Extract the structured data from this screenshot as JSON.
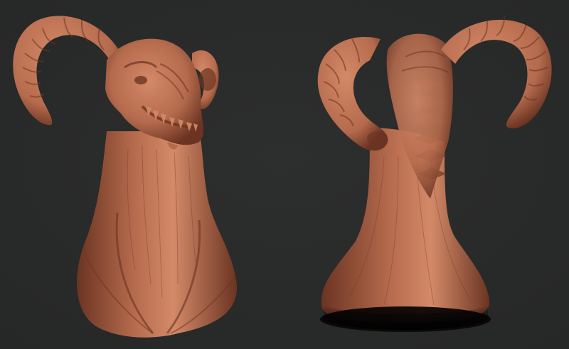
{
  "scene": {
    "background_color": "#2d2e2e",
    "sculpt_color": "#b46a4c",
    "sculpt_shadow": "#6b3422",
    "sculpt_highlight": "#d48a68",
    "views": [
      "front-three-quarter",
      "back"
    ]
  }
}
